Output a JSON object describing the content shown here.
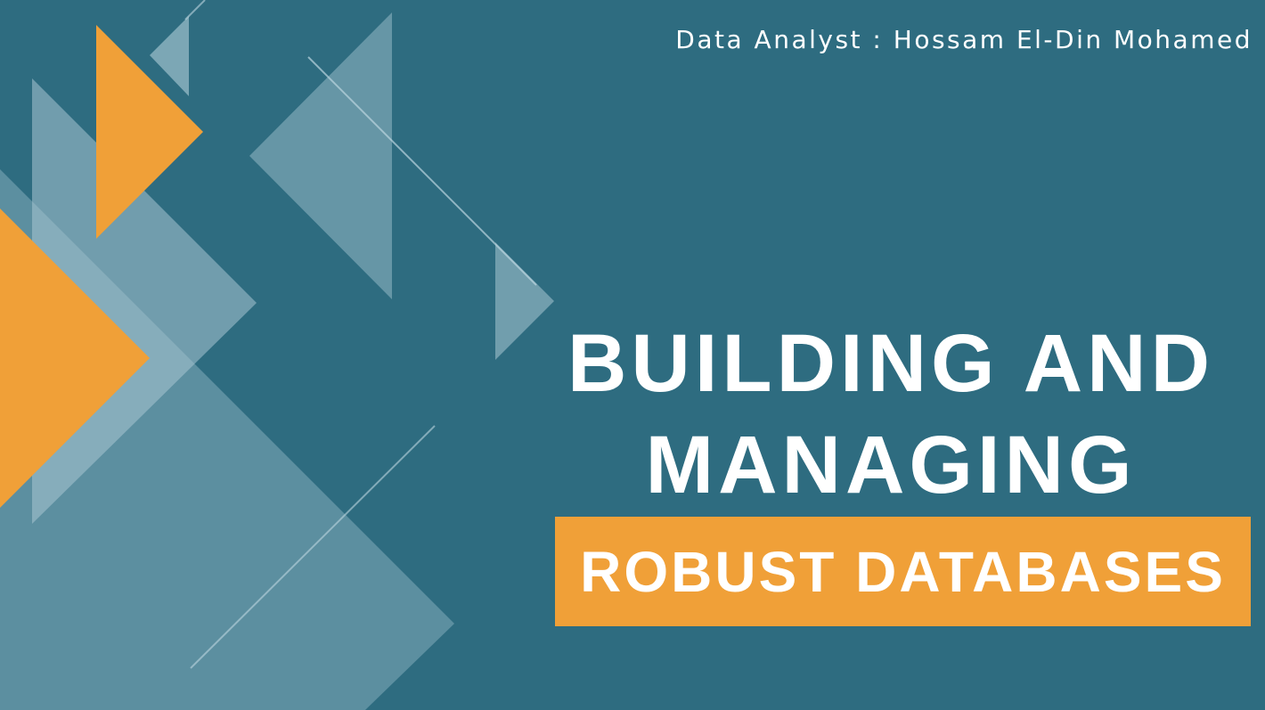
{
  "slide": {
    "author_line": "Data Analyst : Hossam El-Din Mohamed",
    "title_line1": "BUILDING AND",
    "title_line2": "MANAGING",
    "banner_text": "ROBUST DATABASES"
  },
  "colors": {
    "background": "#2e6c80",
    "accent_orange": "#f0a038",
    "shape_light": "#8fb3c0",
    "text": "#ffffff"
  }
}
